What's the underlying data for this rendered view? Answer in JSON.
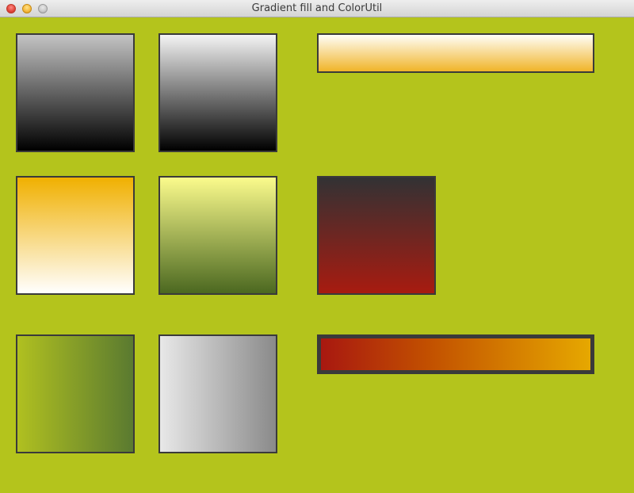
{
  "window": {
    "title": "Gradient fill and ColorUtil",
    "background": "#b4c41c",
    "controls": [
      "close-icon",
      "minimize-icon",
      "maximize-icon"
    ]
  },
  "swatches": [
    {
      "id": "gray-to-black",
      "direction": "vertical",
      "colors": [
        "#c4c4c4",
        "#000000"
      ]
    },
    {
      "id": "white-to-black",
      "direction": "vertical",
      "colors": [
        "#f4f4f4",
        "#000000"
      ]
    },
    {
      "id": "white-to-orange-bar",
      "direction": "vertical",
      "colors": [
        "#fffef8",
        "#f0b429"
      ]
    },
    {
      "id": "orange-to-white",
      "direction": "vertical",
      "colors": [
        "#f0b000",
        "#ffffff"
      ]
    },
    {
      "id": "yellow-to-olive",
      "direction": "vertical",
      "colors": [
        "#fbfb8c",
        "#4b6820"
      ]
    },
    {
      "id": "charcoal-to-red",
      "direction": "vertical",
      "colors": [
        "#323234",
        "#a81b10"
      ]
    },
    {
      "id": "lime-to-green",
      "direction": "horizontal",
      "colors": [
        "#b0c020",
        "#5a7a30"
      ]
    },
    {
      "id": "lightgray-to-gray",
      "direction": "horizontal",
      "colors": [
        "#e8e8e8",
        "#8a8a8a"
      ]
    },
    {
      "id": "red-to-orange-bar",
      "direction": "horizontal",
      "colors": [
        "#a81810",
        "#c25000",
        "#e6a800"
      ]
    }
  ]
}
